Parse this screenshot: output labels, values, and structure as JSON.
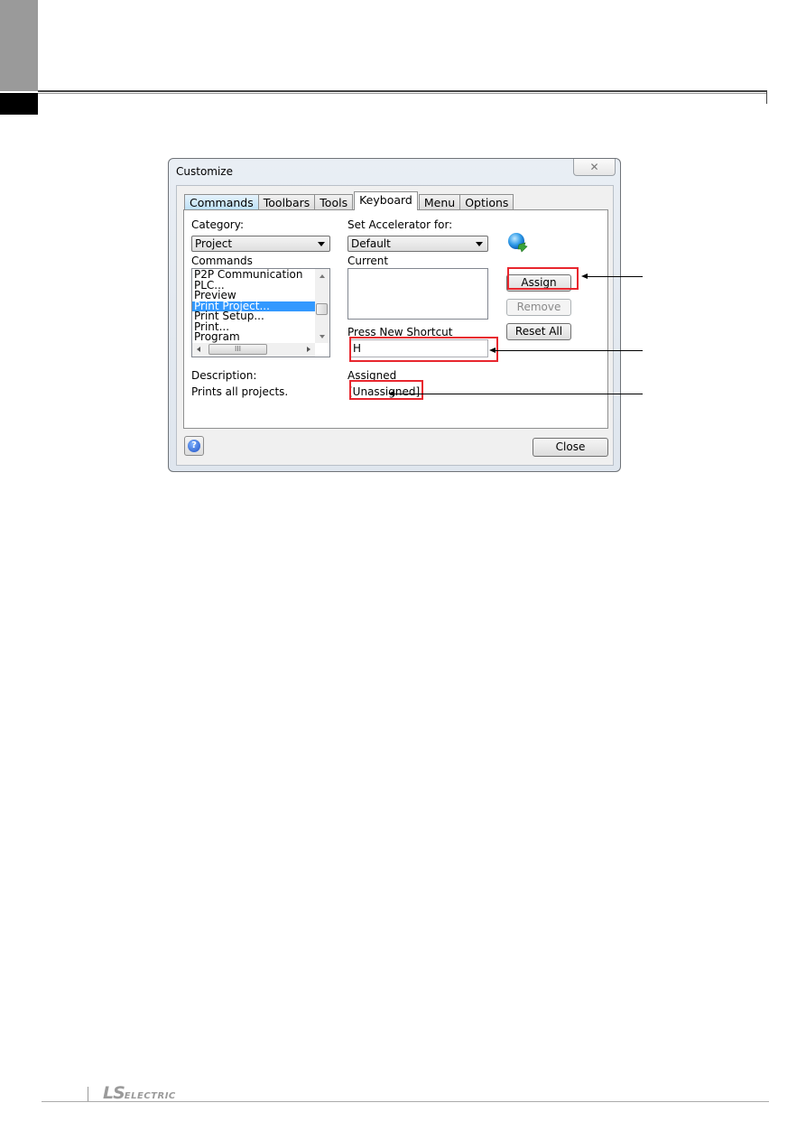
{
  "page": {
    "footer_logo_ls": "LS",
    "footer_logo_electric": "ELECTRIC"
  },
  "dialog": {
    "title": "Customize",
    "close_icon": "close-x-icon",
    "tabs": [
      {
        "label": "Commands",
        "state": "hover"
      },
      {
        "label": "Toolbars",
        "state": "normal"
      },
      {
        "label": "Tools",
        "state": "normal"
      },
      {
        "label": "Keyboard",
        "state": "active"
      },
      {
        "label": "Menu",
        "state": "normal"
      },
      {
        "label": "Options",
        "state": "normal"
      }
    ],
    "keyboard": {
      "category_label": "Category:",
      "category_value": "Project",
      "commands_label": "Commands",
      "commands": [
        {
          "label": "P2P Communication",
          "selected": false
        },
        {
          "label": "PLC...",
          "selected": false
        },
        {
          "label": "Preview",
          "selected": false
        },
        {
          "label": "Print Project...",
          "selected": true
        },
        {
          "label": "Print Setup...",
          "selected": false
        },
        {
          "label": "Print...",
          "selected": false
        },
        {
          "label": "Program",
          "selected": false
        }
      ],
      "hscroll_thumb_grip": "III",
      "accelerator_label": "Set Accelerator for:",
      "accelerator_value": "Default",
      "current_label": "Current",
      "current_value": "",
      "new_shortcut_label": "Press New Shortcut",
      "new_shortcut_value": "H",
      "description_label": "Description:",
      "description_value": "Prints all projects.",
      "assigned_label": "Assigned",
      "assigned_value": "[Unassigned]",
      "assign_button": "Assign",
      "remove_button": "Remove",
      "reset_all_button": "Reset All",
      "app_icon": "globe-refresh-icon"
    },
    "help_button": "?",
    "close_button": "Close"
  },
  "annotation_color": "#e8262e"
}
